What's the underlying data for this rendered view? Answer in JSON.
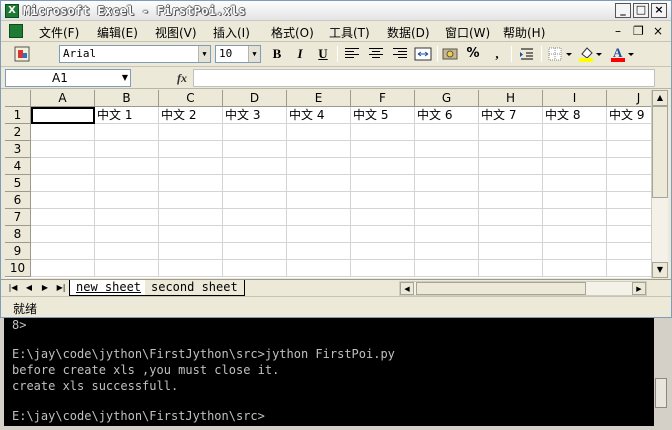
{
  "window": {
    "title": "Microsoft Excel - FirstPoi.xls",
    "app_icon": "X"
  },
  "menu": [
    "文件(F)",
    "编辑(E)",
    "视图(V)",
    "插入(I)",
    "格式(O)",
    "工具(T)",
    "数据(D)",
    "窗口(W)",
    "帮助(H)"
  ],
  "toolbar": {
    "font": "Arial",
    "size": "10",
    "bold": "B",
    "italic": "I",
    "underline": "U",
    "percent": "%",
    "comma": ","
  },
  "formula_bar": {
    "name_box": "A1",
    "fx": "fx",
    "formula": ""
  },
  "grid": {
    "columns": [
      "A",
      "B",
      "C",
      "D",
      "E",
      "F",
      "G",
      "H",
      "I",
      "J"
    ],
    "rows": [
      "1",
      "2",
      "3",
      "4",
      "5",
      "6",
      "7",
      "8",
      "9",
      "10"
    ],
    "row1": [
      "",
      "中文 1",
      "中文 2",
      "中文 3",
      "中文 4",
      "中文 5",
      "中文 6",
      "中文 7",
      "中文 8",
      "中文 9"
    ]
  },
  "sheets": [
    "new sheet",
    "second sheet"
  ],
  "status": "就绪",
  "console": [
    "8>",
    "",
    "E:\\jay\\code\\jython\\FirstJython\\src>jython FirstPoi.py",
    "before create xls ,you must close it.",
    "create xls successfull.",
    "",
    "E:\\jay\\code\\jython\\FirstJython\\src>"
  ],
  "colors": {
    "title_bg": "#e4e4e4",
    "chrome": "#ece9d8",
    "console_bg": "#000000",
    "console_fg": "#c0c0c0"
  }
}
